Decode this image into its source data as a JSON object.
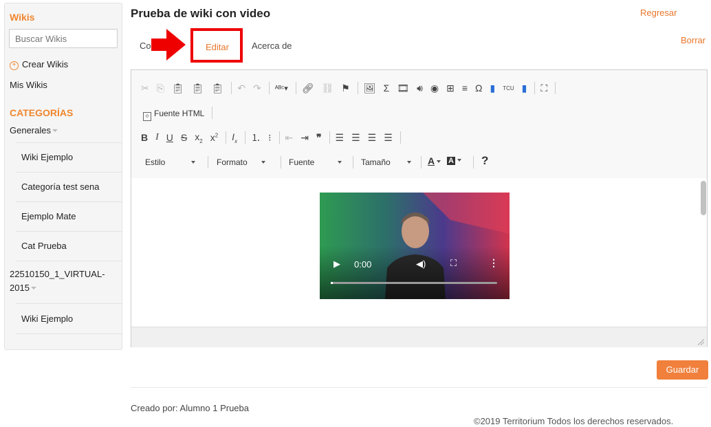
{
  "sidebar": {
    "wikis_heading": "Wikis",
    "search_placeholder": "Buscar Wikis",
    "create_label": "Crear Wikis",
    "my_wikis_label": "Mis Wikis",
    "categories_heading": "CATEGORÍAS",
    "general_label": "Generales",
    "items": [
      "Wiki Ejemplo",
      "Categoría test sena",
      "Ejemplo Mate",
      "Cat Prueba"
    ],
    "virtual_group": [
      "22510150_1_VIRTUAL-",
      "2015"
    ],
    "virtual_items": [
      "Wiki Ejemplo"
    ]
  },
  "header": {
    "title": "Prueba de wiki con video",
    "back_link": "Regresar",
    "delete_link": "Borrar"
  },
  "tabs": {
    "content_partial": "Co",
    "edit": "Editar",
    "about": "Acerca de"
  },
  "editor": {
    "source_button": "Fuente HTML",
    "dropdowns": {
      "style": "Estilo",
      "format": "Formato",
      "font": "Fuente",
      "size": "Tamaño"
    }
  },
  "video": {
    "time": "0:00"
  },
  "actions": {
    "save": "Guardar"
  },
  "footer": {
    "created_by": "Creado por: Alumno 1 Prueba",
    "copyright": "©2019 Territorium Todos los derechos reservados."
  },
  "colors": {
    "accent": "#f0862e",
    "highlight_red": "#e00000",
    "save_button": "#f0803c"
  }
}
